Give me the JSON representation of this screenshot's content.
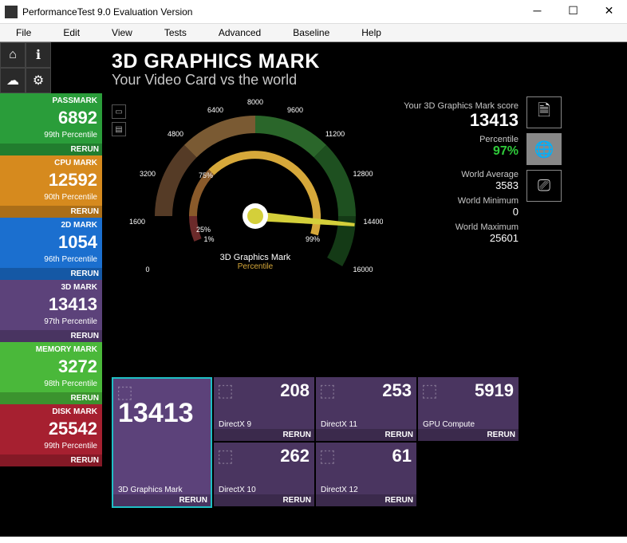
{
  "window": {
    "title": "PerformanceTest 9.0 Evaluation Version"
  },
  "menu": [
    "File",
    "Edit",
    "View",
    "Tests",
    "Advanced",
    "Baseline",
    "Help"
  ],
  "header": {
    "title": "3D GRAPHICS MARK",
    "subtitle": "Your Video Card vs the world"
  },
  "sidebar": [
    {
      "label": "PASSMARK",
      "value": "6892",
      "pct": "99th Percentile",
      "rerun": "RERUN",
      "color": "green"
    },
    {
      "label": "CPU MARK",
      "value": "12592",
      "pct": "90th Percentile",
      "rerun": "RERUN",
      "color": "orange"
    },
    {
      "label": "2D MARK",
      "value": "1054",
      "pct": "96th Percentile",
      "rerun": "RERUN",
      "color": "blue"
    },
    {
      "label": "3D MARK",
      "value": "13413",
      "pct": "97th Percentile",
      "rerun": "RERUN",
      "color": "purple"
    },
    {
      "label": "MEMORY MARK",
      "value": "3272",
      "pct": "98th Percentile",
      "rerun": "RERUN",
      "color": "lime"
    },
    {
      "label": "DISK MARK",
      "value": "25542",
      "pct": "99th Percentile",
      "rerun": "RERUN",
      "color": "red"
    }
  ],
  "gauge": {
    "ticks": [
      "0",
      "1600",
      "3200",
      "4800",
      "6400",
      "8000",
      "9600",
      "11200",
      "12800",
      "14400",
      "16000"
    ],
    "title": "3D Graphics Mark",
    "subtitle": "Percentile",
    "marker_75": "75%",
    "marker_25": "25%",
    "marker_1": "1%",
    "marker_99": "99%"
  },
  "stats": {
    "score_label": "Your 3D Graphics Mark score",
    "score": "13413",
    "pct_label": "Percentile",
    "pct": "97%",
    "avg_label": "World Average",
    "avg": "3583",
    "min_label": "World Minimum",
    "min": "0",
    "max_label": "World Maximum",
    "max": "25601"
  },
  "subtiles": {
    "big": {
      "value": "13413",
      "label": "3D Graphics Mark",
      "rerun": "RERUN"
    },
    "row": [
      {
        "value": "208",
        "label": "DirectX 9",
        "rerun": "RERUN"
      },
      {
        "value": "253",
        "label": "DirectX 11",
        "rerun": "RERUN"
      },
      {
        "value": "5919",
        "label": "GPU Compute",
        "rerun": "RERUN"
      },
      {
        "value": "262",
        "label": "DirectX 10",
        "rerun": "RERUN"
      },
      {
        "value": "61",
        "label": "DirectX 12",
        "rerun": "RERUN"
      }
    ]
  }
}
